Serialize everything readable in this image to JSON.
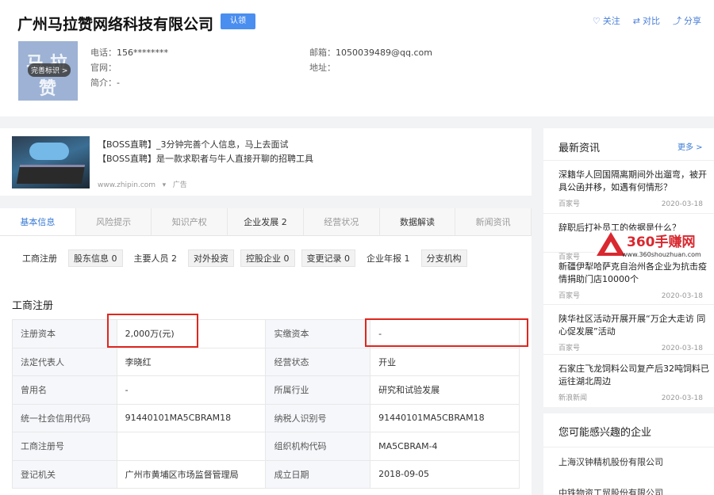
{
  "header": {
    "company_name": "广州马拉赞网络科技有限公司",
    "cert_badge": "认领",
    "actions": {
      "follow": "关注",
      "compare": "对比",
      "share": "分享"
    },
    "logo_chars": [
      "马",
      "拉",
      "赞"
    ],
    "logo_overlay": "完善标识 >",
    "phone_label": "电话：",
    "phone_value": "156********",
    "website_label": "官网：",
    "website_value": "",
    "intro_label": "简介：",
    "intro_value": "-",
    "email_label": "邮箱：",
    "email_value": "1050039489@qq.com",
    "address_label": "地址：",
    "address_value": ""
  },
  "ad": {
    "line1": "【BOSS直聘】_3分钟完善个人信息，马上去面试",
    "line2": "【BOSS直聘】是一款求职者与牛人直接开聊的招聘工具",
    "source": "www.zhipin.com",
    "ad_tag": "广告"
  },
  "tabs": [
    "基本信息",
    "风险提示",
    "知识产权",
    "企业发展 2",
    "经营状况",
    "数据解读",
    "新闻资讯"
  ],
  "subtabs": [
    {
      "label": "工商注册"
    },
    {
      "label": "股东信息 0"
    },
    {
      "label": "主要人员 2"
    },
    {
      "label": "对外投资"
    },
    {
      "label": "控股企业 0"
    },
    {
      "label": "变更记录 0"
    },
    {
      "label": "企业年报 1"
    },
    {
      "label": "分支机构"
    }
  ],
  "registration": {
    "title": "工商注册",
    "rows": [
      {
        "k1": "注册资本",
        "v1": "2,000万(元)",
        "k2": "实缴资本",
        "v2": "-"
      },
      {
        "k1": "法定代表人",
        "v1": "李晓红",
        "k2": "经营状态",
        "v2": "开业"
      },
      {
        "k1": "曾用名",
        "v1": "-",
        "k2": "所属行业",
        "v2": "研究和试验发展"
      },
      {
        "k1": "统一社会信用代码",
        "v1": "91440101MA5CBRAM18",
        "k2": "纳税人识别号",
        "v2": "91440101MA5CBRAM18"
      },
      {
        "k1": "工商注册号",
        "v1": "",
        "k2": "组织机构代码",
        "v2": "MA5CBRAM-4"
      },
      {
        "k1": "登记机关",
        "v1": "广州市黄埔区市场监督管理局",
        "k2": "成立日期",
        "v2": "2018-09-05"
      }
    ]
  },
  "news": {
    "title": "最新资讯",
    "more": "更多 >",
    "items": [
      {
        "title": "深籍华人回国隔离期间外出遛弯，被开具公函并移，如遇有何情形？",
        "source": "百家号",
        "date": "2020-03-18"
      },
      {
        "title": "辞职后打补员工的依据是什么？",
        "source": "百家号",
        "date": ""
      },
      {
        "title": "新疆伊犁哈萨克自治州各企业为抗击疫情捐助门店10000个",
        "source": "百家号",
        "date": "2020-03-18"
      },
      {
        "title": "陕华社区活动开展开展“万企大走访 同心促发展”活动",
        "source": "百家号",
        "date": "2020-03-18"
      },
      {
        "title": "石家庄飞龙饲料公司复产后32吨饲料已运往湖北周边",
        "source": "新浪新闻",
        "date": "2020-03-18"
      }
    ]
  },
  "watermark": {
    "text": "360手赚网",
    "url": "www.360shouzhuan.com"
  },
  "interest": {
    "title": "您可能感兴趣的企业",
    "items": [
      "上海汉钟精机股份有限公司",
      "中铁物资工贸股份有限公司"
    ]
  }
}
